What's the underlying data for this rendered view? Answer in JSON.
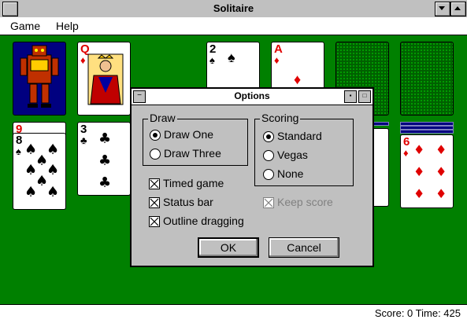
{
  "window": {
    "title": "Solitaire"
  },
  "menu": {
    "items": [
      {
        "label": "Game"
      },
      {
        "label": "Help"
      }
    ]
  },
  "status": {
    "text": "Score: 0 Time: 425"
  },
  "cards": {
    "waste": {
      "rank": "Q",
      "suit": "♦"
    },
    "foundation1": {
      "rank": "2",
      "suit": "♠"
    },
    "foundation2": {
      "rank": "A",
      "suit": "♦"
    },
    "tableau1": {
      "rank": "8",
      "suit": "♠",
      "under": "9"
    },
    "tableau2": {
      "rank": "3",
      "suit": "♣"
    },
    "tableau7": {
      "rank": "6",
      "suit": "♦"
    }
  },
  "dialog": {
    "title": "Options",
    "draw": {
      "label": "Draw",
      "options": [
        {
          "label": "Draw One",
          "selected": true
        },
        {
          "label": "Draw Three",
          "selected": false
        }
      ]
    },
    "scoring": {
      "label": "Scoring",
      "options": [
        {
          "label": "Standard",
          "selected": true
        },
        {
          "label": "Vegas",
          "selected": false
        },
        {
          "label": "None",
          "selected": false
        }
      ]
    },
    "checks": [
      {
        "label": "Timed game",
        "checked": true
      },
      {
        "label": "Status bar",
        "checked": true
      },
      {
        "label": "Outline dragging",
        "checked": true
      },
      {
        "label": "Keep score",
        "checked": true,
        "disabled": true
      }
    ],
    "ok_label": "OK",
    "cancel_label": "Cancel"
  }
}
